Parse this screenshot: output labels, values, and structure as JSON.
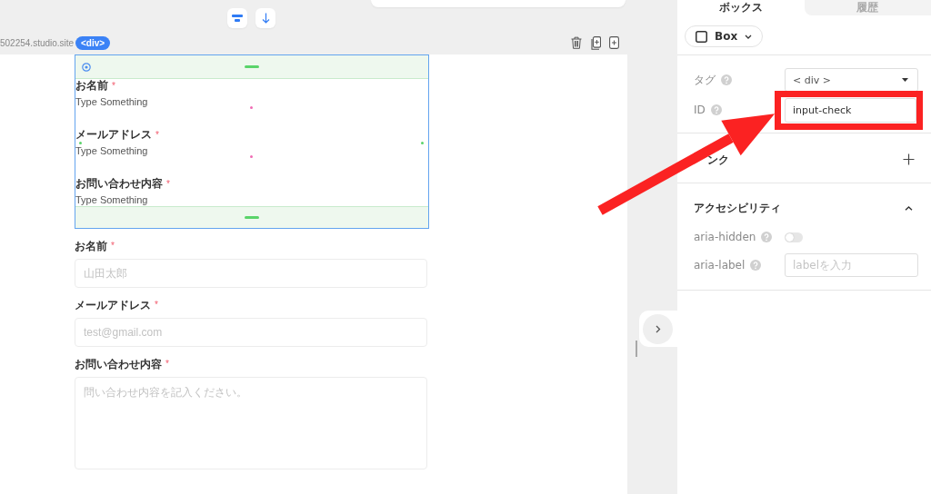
{
  "canvas": {
    "site_url": "502254.studio.site",
    "selected_tag": "<div>",
    "selection": {
      "fields": [
        {
          "label": "お名前",
          "required_mark": "*",
          "value": "Type Something"
        },
        {
          "label": "メールアドレス",
          "required_mark": "*",
          "value": "Type Something"
        },
        {
          "label": "お問い合わせ内容",
          "required_mark": "*",
          "value": "Type Something"
        }
      ]
    },
    "form": {
      "fields": [
        {
          "kind": "input",
          "label": "お名前",
          "required_mark": "*",
          "placeholder": "山田太郎"
        },
        {
          "kind": "input",
          "label": "メールアドレス",
          "required_mark": "*",
          "placeholder": "test@gmail.com"
        },
        {
          "kind": "textarea",
          "label": "お問い合わせ内容",
          "required_mark": "*",
          "placeholder": "問い合わせ内容を記入ください。"
        }
      ]
    }
  },
  "panel": {
    "tabs": [
      {
        "label": "ボックス",
        "selected": true
      },
      {
        "label": "履歴",
        "selected": false
      }
    ],
    "element_type": "Box",
    "properties": [
      {
        "kind": "select",
        "label": "タグ",
        "value": "< div >"
      },
      {
        "kind": "text",
        "label": "ID",
        "value": "input-check",
        "highlighted": true
      }
    ],
    "link_section": {
      "title": "ンク"
    },
    "accessibility": {
      "title": "アクセシビリティ",
      "expanded": true,
      "rows": [
        {
          "kind": "toggle",
          "label": "aria-hidden",
          "on": false
        },
        {
          "kind": "text",
          "label": "aria-label",
          "placeholder": "labelを入力"
        }
      ]
    }
  },
  "annotation_arrow": true
}
